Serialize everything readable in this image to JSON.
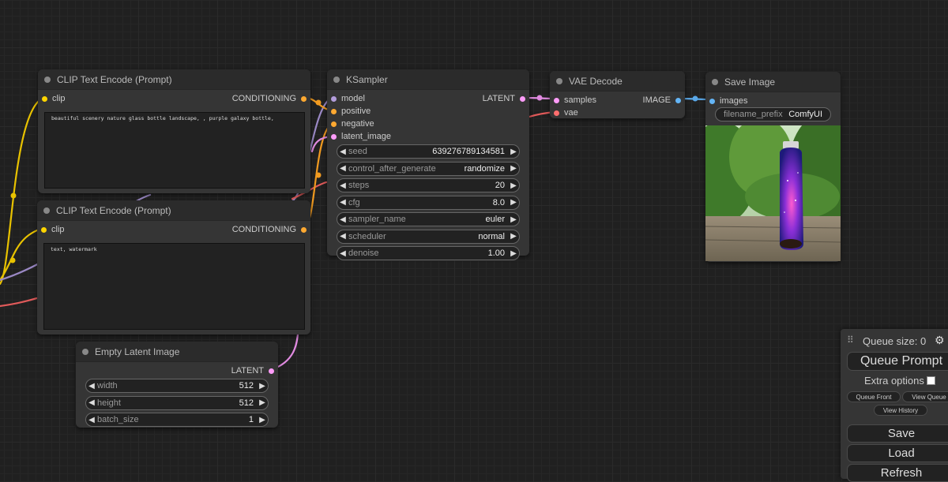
{
  "colors": {
    "clip": "#ffd500",
    "conditioning": "#ffa931",
    "model": "#b39ddb",
    "latent": "#ff9cf9",
    "vae": "#ff6e6e",
    "image": "#64b5f6"
  },
  "clip_text_encode_1": {
    "title": "CLIP Text Encode (Prompt)",
    "input_label": "clip",
    "output_label": "CONDITIONING",
    "text": "beautiful scenery nature glass bottle landscape, , purple galaxy bottle,"
  },
  "clip_text_encode_2": {
    "title": "CLIP Text Encode (Prompt)",
    "input_label": "clip",
    "output_label": "CONDITIONING",
    "text": "text, watermark"
  },
  "ksampler": {
    "title": "KSampler",
    "inputs": [
      "model",
      "positive",
      "negative",
      "latent_image"
    ],
    "output_label": "LATENT",
    "widgets": [
      {
        "label": "seed",
        "value": "639276789134581"
      },
      {
        "label": "control_after_generate",
        "value": "randomize"
      },
      {
        "label": "steps",
        "value": "20"
      },
      {
        "label": "cfg",
        "value": "8.0"
      },
      {
        "label": "sampler_name",
        "value": "euler"
      },
      {
        "label": "scheduler",
        "value": "normal"
      },
      {
        "label": "denoise",
        "value": "1.00"
      }
    ]
  },
  "vae_decode": {
    "title": "VAE Decode",
    "inputs": [
      "samples",
      "vae"
    ],
    "output_label": "IMAGE"
  },
  "save_image": {
    "title": "Save Image",
    "input_label": "images",
    "prefix_label": "filename_prefix",
    "prefix_value": "ComfyUI"
  },
  "empty_latent": {
    "title": "Empty Latent Image",
    "output_label": "LATENT",
    "widgets": [
      {
        "label": "width",
        "value": "512"
      },
      {
        "label": "height",
        "value": "512"
      },
      {
        "label": "batch_size",
        "value": "1"
      }
    ]
  },
  "queue": {
    "size_label": "Queue size: 0",
    "queue_prompt": "Queue Prompt",
    "extra_options": "Extra options",
    "queue_front": "Queue Front",
    "view_queue": "View Queue",
    "view_history": "View History",
    "save": "Save",
    "load": "Load",
    "refresh": "Refresh"
  }
}
